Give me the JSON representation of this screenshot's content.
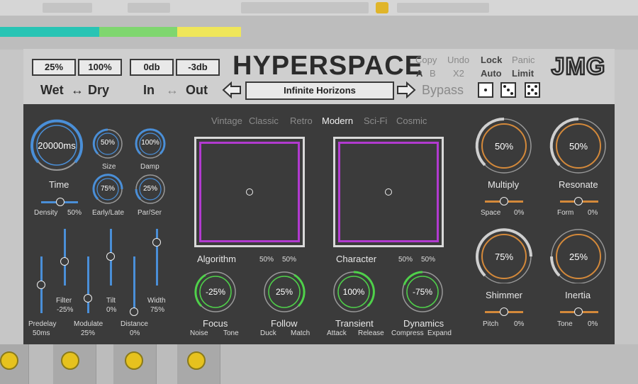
{
  "header": {
    "wet_value": "25%",
    "dry_value": "100%",
    "in_value": "0db",
    "out_value": "-3db",
    "wet_label": "Wet",
    "dry_label": "Dry",
    "wet_dry_arrow": "↔",
    "in_label": "In",
    "out_label": "Out",
    "in_out_arrow": "↔",
    "title": "HYPERSPACE",
    "preset_name": "Infinite Horizons",
    "copy_label": "Copy",
    "undo_label": "Undo",
    "lock_label": "Lock",
    "panic_label": "Panic",
    "a_label": "A",
    "b_label": "B",
    "x2_label": "X2",
    "auto_label": "Auto",
    "limit_label": "Limit",
    "bypass_label": "Bypass",
    "logo_text": "JMG"
  },
  "tabs": [
    "Vintage",
    "Classic",
    "Retro",
    "Modern",
    "Sci-Fi",
    "Cosmic"
  ],
  "left": {
    "time_value": "20000ms",
    "time_label": "Time",
    "size_value": "50%",
    "size_label": "Size",
    "damp_value": "100%",
    "damp_label": "Damp",
    "early_value": "75%",
    "early_label": "Early/Late",
    "parser_value": "25%",
    "parser_label": "Par/Ser",
    "density_label": "Density",
    "density_value": "50%",
    "sliders": {
      "predelay_label": "Predelay",
      "predelay_value": "50ms",
      "filter_label": "Filter",
      "filter_value": "-25%",
      "modulate_label": "Modulate",
      "modulate_value": "25%",
      "tilt_label": "Tilt",
      "tilt_value": "0%",
      "distance_label": "Distance",
      "distance_value": "0%",
      "width_label": "Width",
      "width_value": "75%"
    }
  },
  "center": {
    "algorithm_label": "Algorithm",
    "algorithm_x": "50%",
    "algorithm_y": "50%",
    "character_label": "Character",
    "character_x": "50%",
    "character_y": "50%",
    "focus_value": "-25%",
    "focus_label": "Focus",
    "focus_left": "Noise",
    "focus_right": "Tone",
    "follow_value": "25%",
    "follow_label": "Follow",
    "follow_left": "Duck",
    "follow_right": "Match",
    "transient_value": "100%",
    "transient_label": "Transient",
    "transient_left": "Attack",
    "transient_right": "Release",
    "dynamics_value": "-75%",
    "dynamics_label": "Dynamics",
    "dynamics_left": "Compress",
    "dynamics_right": "Expand"
  },
  "right": {
    "multiply_value": "50%",
    "multiply_label": "Multiply",
    "space_label": "Space",
    "space_value": "0%",
    "resonate_value": "50%",
    "resonate_label": "Resonate",
    "form_label": "Form",
    "form_value": "0%",
    "shimmer_value": "75%",
    "shimmer_label": "Shimmer",
    "pitch_label": "Pitch",
    "pitch_value": "0%",
    "inertia_value": "25%",
    "inertia_label": "Inertia",
    "tone_label": "Tone",
    "tone_value": "0%"
  },
  "colors": {
    "blue": "#4a8fd8",
    "green": "#4fd14a",
    "orange": "#d4893a",
    "purple": "#b23ad0",
    "panel": "#3b3b3b"
  }
}
